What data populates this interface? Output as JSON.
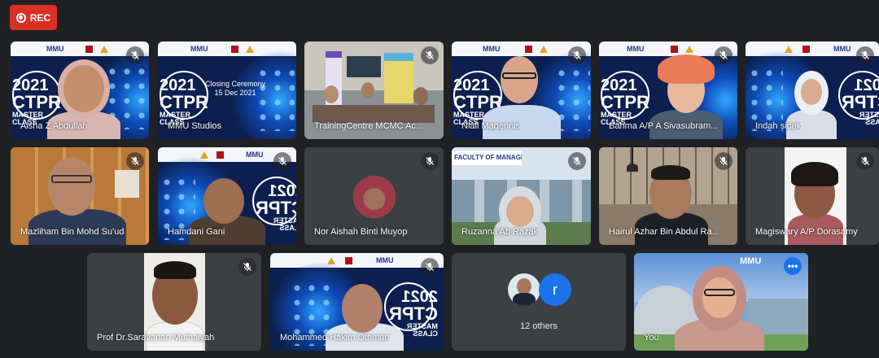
{
  "recording": {
    "label": "REC"
  },
  "slide_text": {
    "year": "2021",
    "ctpr": "CTPR",
    "master": "MASTER",
    "klass": "CLASS",
    "mmu": "MMU",
    "closing": "Closing Ceremony",
    "closing_date": "15 Dec 2021",
    "faculty": "FACULTY OF MANAGEMENT"
  },
  "participants": [
    {
      "name": "Aisha Z Abdullah",
      "muted": true
    },
    {
      "name": "MMU Studios",
      "muted": false
    },
    {
      "name": "TrainingCentre MCMC Ac...",
      "muted": true
    },
    {
      "name": "Niall Magennis",
      "muted": true
    },
    {
      "name": "Bahma A/P A Sivasubram...",
      "muted": true
    },
    {
      "name": "Indah sidek",
      "muted": true
    },
    {
      "name": "Mazliham Bin Mohd Su'ud",
      "muted": true
    },
    {
      "name": "Hamdani Gani",
      "muted": true
    },
    {
      "name": "Nor Aishah Binti Muyop",
      "muted": true
    },
    {
      "name": "Ruzanna Ab Razak",
      "muted": true
    },
    {
      "name": "Hairul Azhar Bin Abdul Ra...",
      "muted": true
    },
    {
      "name": "Magiswary A/P Dorasamy",
      "muted": true
    },
    {
      "name": "Prof Dr.Saravanan Muthaiyah",
      "muted": true
    },
    {
      "name": "Mohammed Hakim Othman",
      "muted": true
    }
  ],
  "others": {
    "label": "12 others",
    "avatar_letter": "r"
  },
  "self": {
    "name": "You"
  },
  "colors": {
    "rec": "#d93025",
    "background": "#202124",
    "tile": "#3c4043",
    "accent": "#1a73e8"
  }
}
